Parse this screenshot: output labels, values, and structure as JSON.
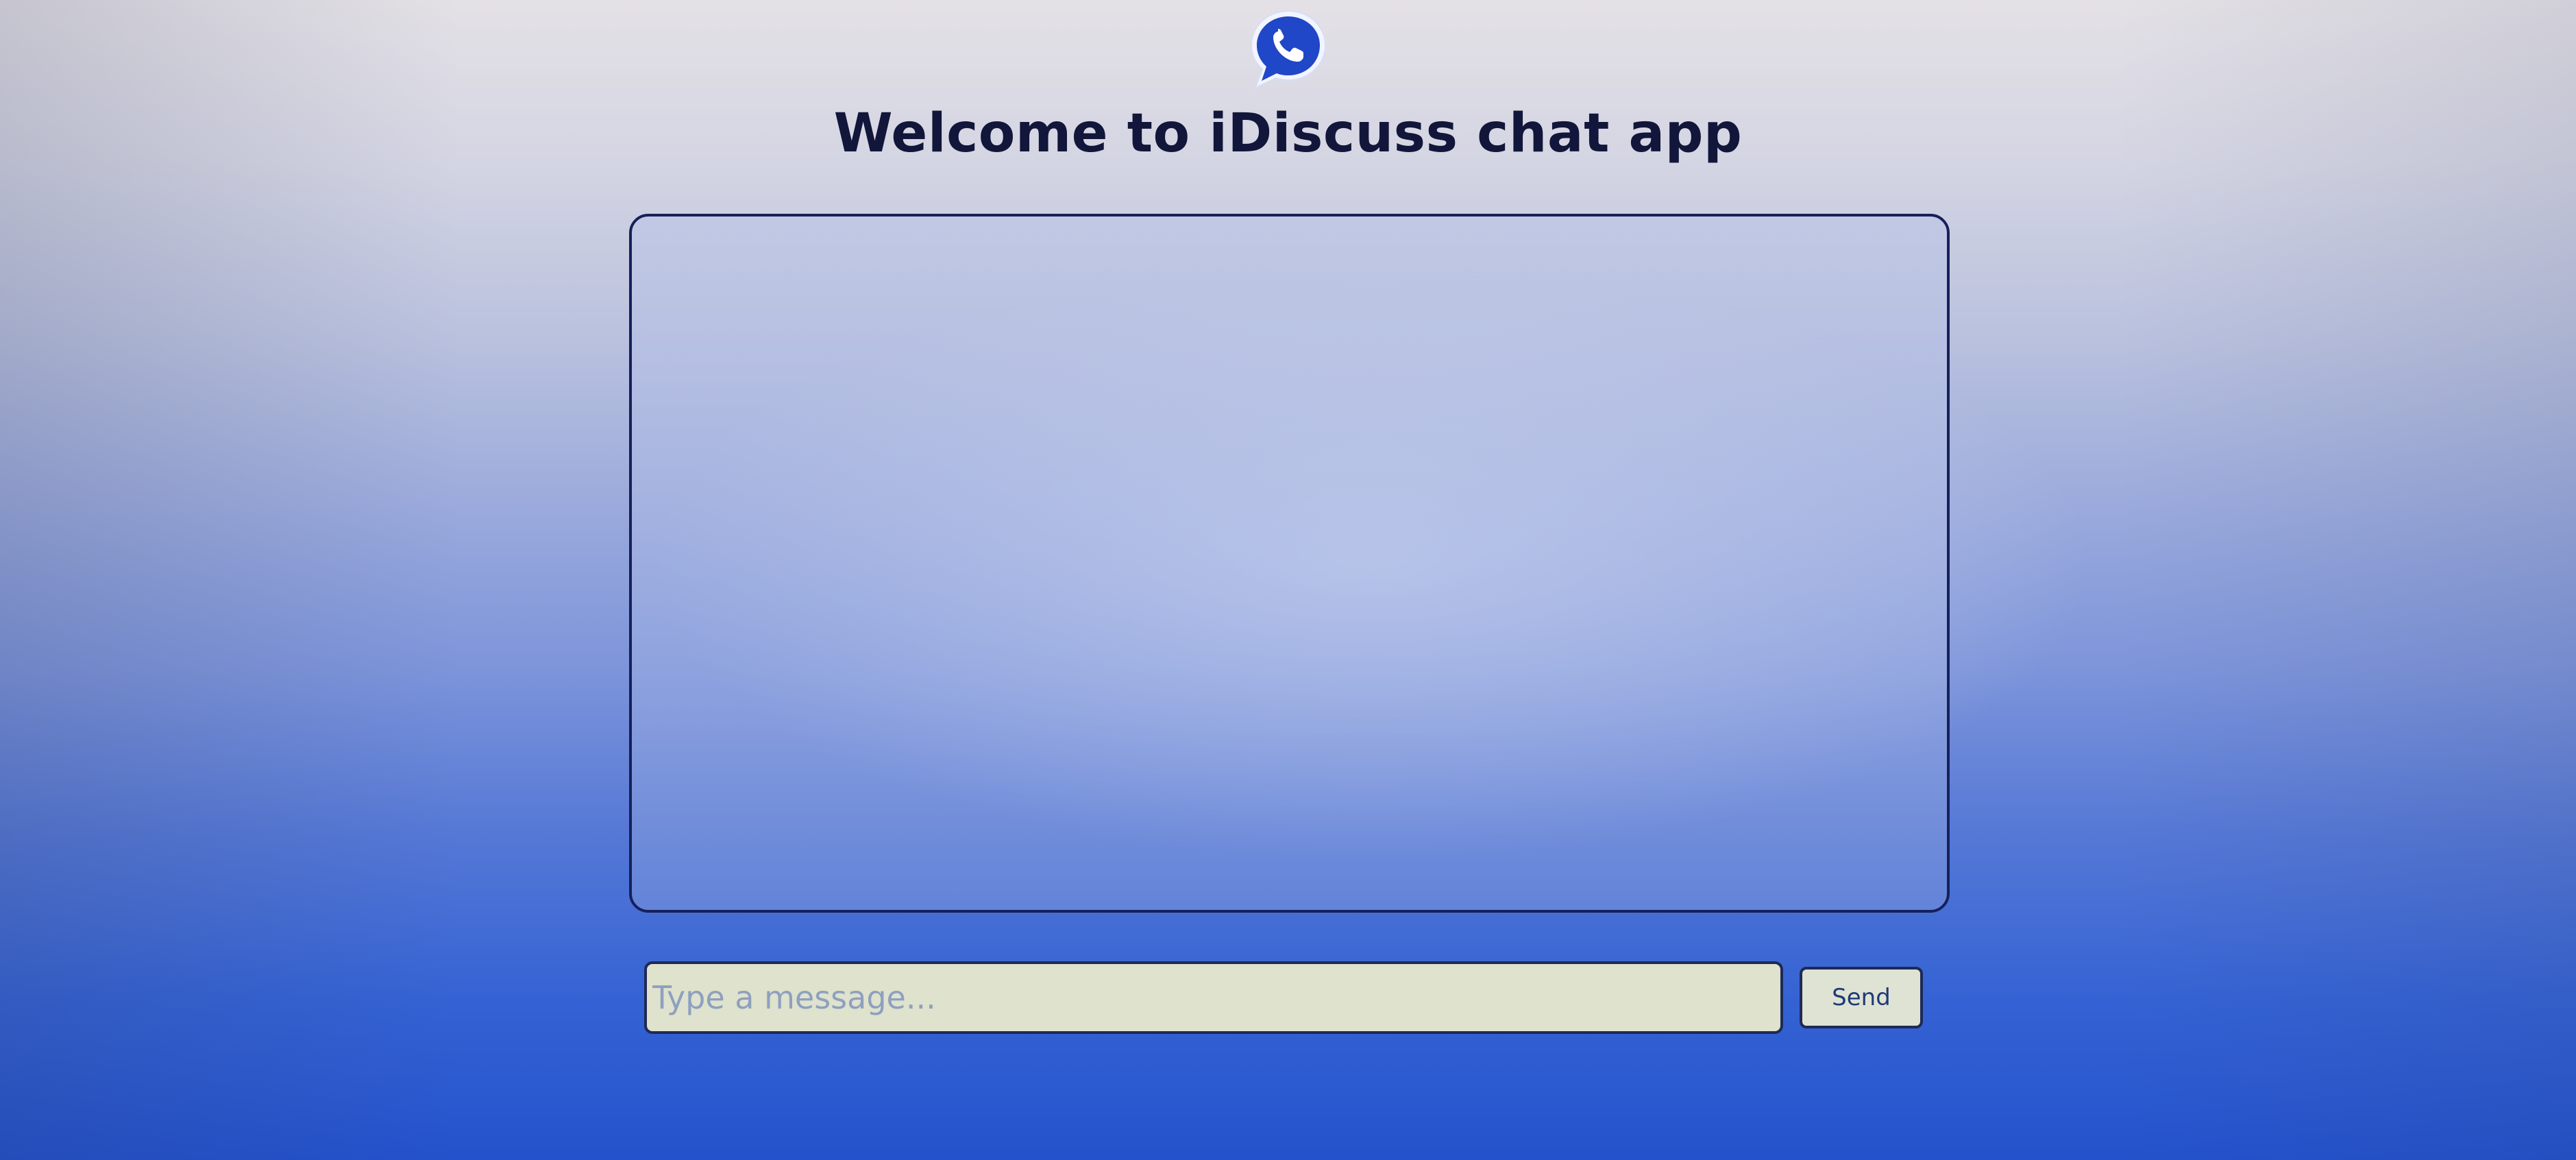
{
  "app": {
    "title": "Welcome to iDiscuss chat app",
    "logo_icon": "phone-chat-bubble-icon"
  },
  "chat": {
    "messages": []
  },
  "composer": {
    "placeholder": "Type a message...",
    "value": "",
    "send_label": "Send"
  },
  "colors": {
    "title_text": "#11163a",
    "border": "#16205a",
    "logo_fill": "#1f47c8",
    "input_bg": "#dfe2cc"
  }
}
